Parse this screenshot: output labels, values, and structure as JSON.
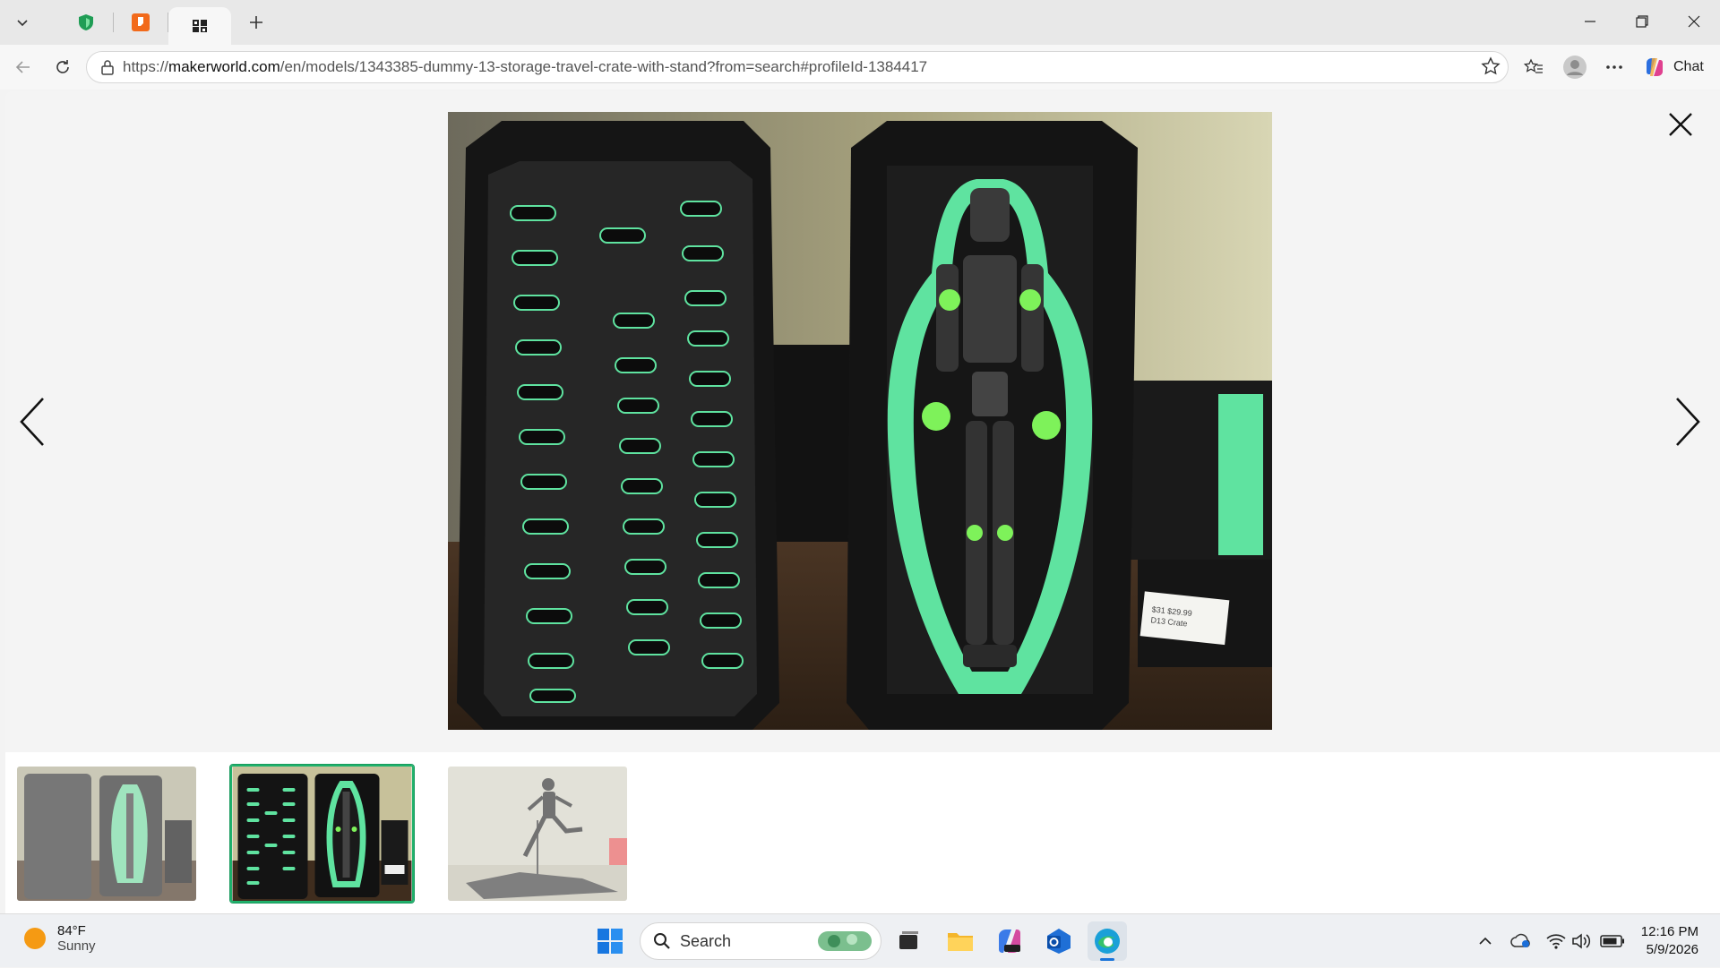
{
  "browser": {
    "tabs": [
      {
        "icon": "green-shield-favicon",
        "label": ""
      },
      {
        "icon": "orange-app-favicon",
        "label": ""
      },
      {
        "icon": "makerworld-favicon",
        "label": ""
      }
    ],
    "address": {
      "prefix": "https://",
      "domain": "makerworld.com",
      "path": "/en/models/1343385-dummy-13-storage-travel-crate-with-stand?from=search#profileId-1384417"
    },
    "chat_label": "Chat"
  },
  "viewer": {
    "main_image_alt": "Dummy 13 storage travel crate with green insert",
    "price_tag": "$31 $29.99\nD13 Crate",
    "thumbnails": [
      {
        "state": "dim"
      },
      {
        "state": "selected"
      },
      {
        "state": "dim"
      }
    ]
  },
  "taskbar": {
    "weather": {
      "temp": "84°F",
      "condition": "Sunny"
    },
    "search_placeholder": "Search",
    "clock": {
      "time": "12:16 PM",
      "date": "5/9/2026"
    }
  },
  "colors": {
    "accent_green": "#5fe3a0",
    "selection_border": "#1fb26c",
    "crate_black": "#1c1c1c"
  }
}
